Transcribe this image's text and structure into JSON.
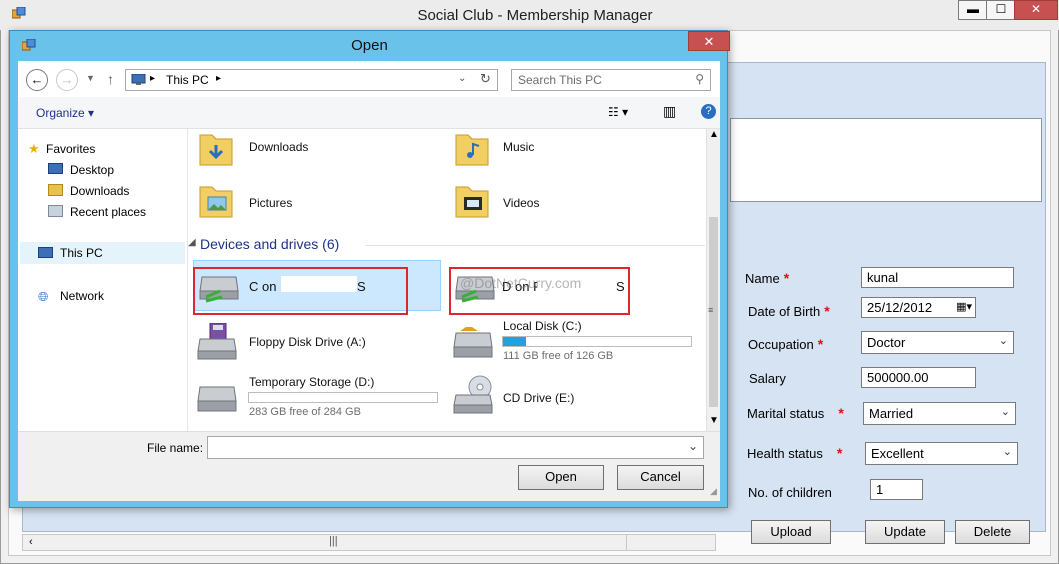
{
  "main_window": {
    "title": "Social Club - Membership Manager",
    "minimize": "▬",
    "maximize": "☐",
    "close": "✕"
  },
  "form": {
    "name_label": "Name",
    "name_value": "kunal",
    "dob_label": "Date of Birth",
    "dob_value": "25/12/2012",
    "occupation_label": "Occupation",
    "occupation_value": "Doctor",
    "salary_label": "Salary",
    "salary_value": "500000.00",
    "marital_label": "Marital status",
    "marital_value": "Married",
    "health_label": "Health status",
    "health_value": "Excellent",
    "children_label": "No. of children",
    "children_value": "1",
    "required_mark": "*",
    "upload": "Upload",
    "update": "Update",
    "delete": "Delete"
  },
  "dialog": {
    "title": "Open",
    "close": "✕",
    "breadcrumb": "This PC",
    "search_placeholder": "Search This PC",
    "organize": "Organize",
    "nav": {
      "favorites": "Favorites",
      "desktop": "Desktop",
      "downloads": "Downloads",
      "recent": "Recent places",
      "this_pc": "This PC",
      "network": "Network"
    },
    "folders": [
      "Downloads",
      "Music",
      "Pictures",
      "Videos"
    ],
    "devices_heading": "Devices and drives (6)",
    "drives": {
      "c_on": "C on P",
      "c_on_suffix": "S",
      "d_on": "D on F",
      "d_on_suffix": "S",
      "floppy": "Floppy Disk Drive (A:)",
      "local": "Local Disk (C:)",
      "local_free": "111 GB free of 126 GB",
      "temp": "Temporary Storage (D:)",
      "temp_free": "283 GB free of 284 GB",
      "cd": "CD Drive (E:)"
    },
    "drive_usage": {
      "local_c_used_fraction": 0.12,
      "temp_d_used_fraction": 0.0
    },
    "filename_label": "File name:",
    "filename_value": "",
    "open_btn": "Open",
    "cancel_btn": "Cancel"
  },
  "watermark": "@DotNetCurry.com",
  "colors": {
    "dialog_frame": "#69c2ea",
    "highlight_box": "#d9282e",
    "selected_item": "#cce8ff",
    "capacity_fill": "#26a0da"
  }
}
